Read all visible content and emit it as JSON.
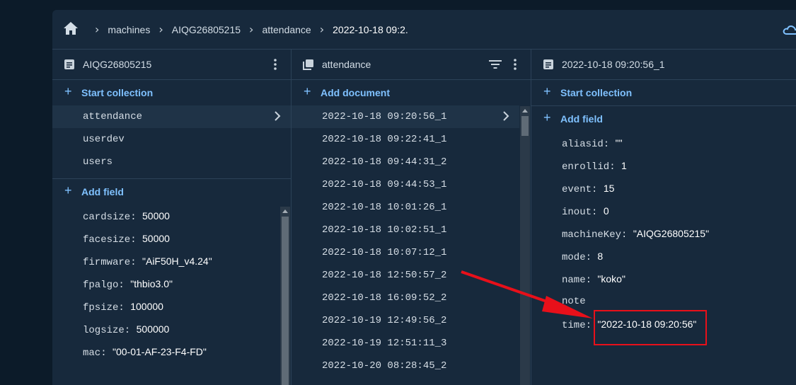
{
  "breadcrumb": {
    "items": [
      "machines",
      "AIQG26805215",
      "attendance",
      "2022-10-18 09:2."
    ]
  },
  "columns": {
    "col1": {
      "title": "AIQG26805215",
      "start_collection": "Start collection",
      "collections": [
        "attendance",
        "userdev",
        "users"
      ],
      "add_field": "Add field",
      "fields": [
        {
          "key": "cardsize",
          "value": "50000"
        },
        {
          "key": "facesize",
          "value": "50000"
        },
        {
          "key": "firmware",
          "value": "\"AiF50H_v4.24\""
        },
        {
          "key": "fpalgo",
          "value": "\"thbio3.0\""
        },
        {
          "key": "fpsize",
          "value": "100000"
        },
        {
          "key": "logsize",
          "value": "500000"
        },
        {
          "key": "mac",
          "value": "\"00-01-AF-23-F4-FD\""
        }
      ]
    },
    "col2": {
      "title": "attendance",
      "add_document": "Add document",
      "documents": [
        "2022-10-18 09:20:56_1",
        "2022-10-18 09:22:41_1",
        "2022-10-18 09:44:31_2",
        "2022-10-18 09:44:53_1",
        "2022-10-18 10:01:26_1",
        "2022-10-18 10:02:51_1",
        "2022-10-18 10:07:12_1",
        "2022-10-18 12:50:57_2",
        "2022-10-18 16:09:52_2",
        "2022-10-19 12:49:56_2",
        "2022-10-19 12:51:11_3",
        "2022-10-20 08:28:45_2"
      ]
    },
    "col3": {
      "title": "2022-10-18 09:20:56_1",
      "start_collection": "Start collection",
      "add_field": "Add field",
      "fields": [
        {
          "key": "aliasid",
          "value": "\"\""
        },
        {
          "key": "enrollid",
          "value": "1"
        },
        {
          "key": "event",
          "value": "15"
        },
        {
          "key": "inout",
          "value": "0"
        },
        {
          "key": "machineKey",
          "value": "\"AIQG26805215\""
        },
        {
          "key": "mode",
          "value": "8"
        },
        {
          "key": "name",
          "value": "\"koko\""
        },
        {
          "key": "note",
          "value": ""
        },
        {
          "key": "time",
          "value": "\"2022-10-18 09:20:56\""
        }
      ]
    }
  },
  "colors": {
    "accent": "#7fc1ff",
    "annotation": "#e8101a"
  }
}
